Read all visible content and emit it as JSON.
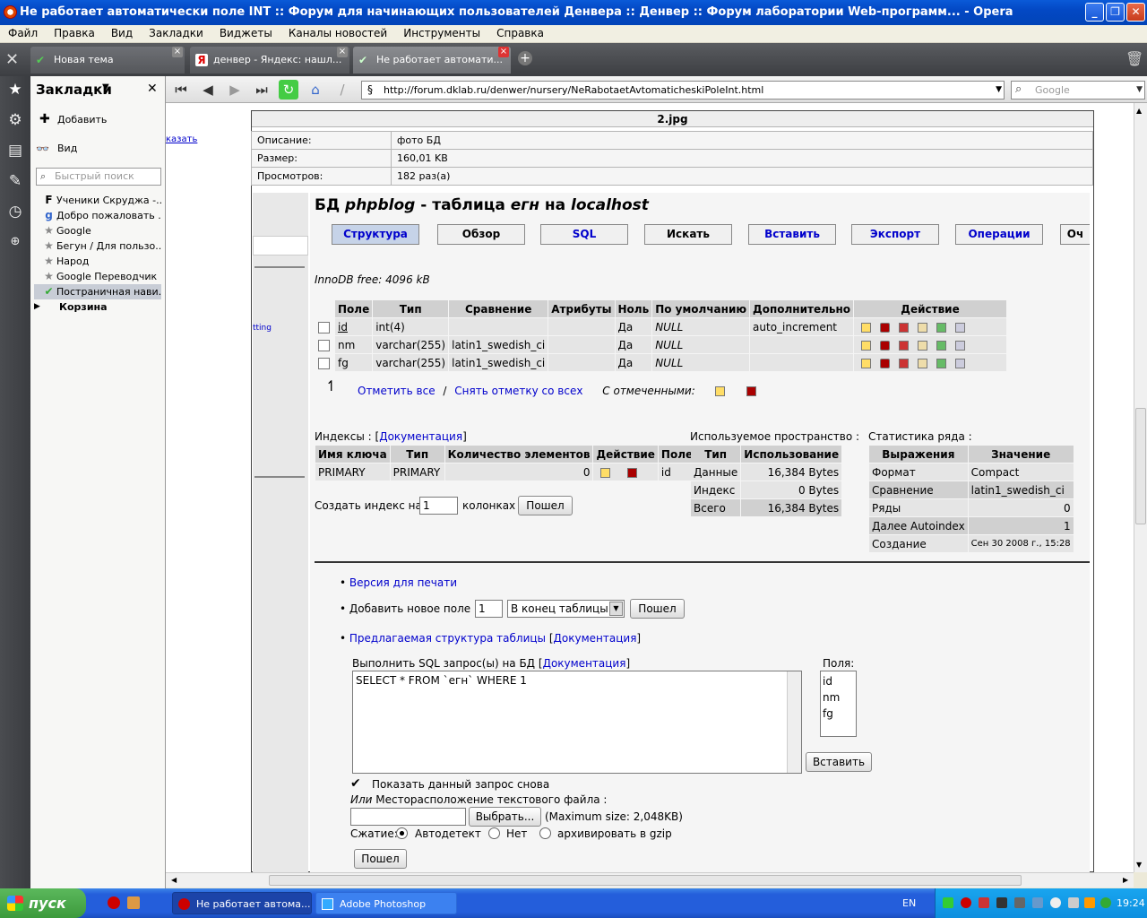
{
  "window": {
    "title": "Не работает автоматически поле INT :: Форум для начинающих пользователей Денвера :: Денвер :: Форум лаборатории Web-программ... - Opera"
  },
  "menu": [
    "Файл",
    "Правка",
    "Вид",
    "Закладки",
    "Виджеты",
    "Каналы новостей",
    "Инструменты",
    "Справка"
  ],
  "tabs": [
    {
      "label": "Новая тема"
    },
    {
      "label": "денвер - Яндекс: нашл..."
    },
    {
      "label": "Не работает автомати..."
    }
  ],
  "panel": {
    "title": "Закладки",
    "add": "Добавить",
    "view": "Вид",
    "search_placeholder": "Быстрый поиск",
    "items": [
      {
        "label": "Ученики Скруджа -..."
      },
      {
        "label": "Добро пожаловать ..."
      },
      {
        "label": "Google"
      },
      {
        "label": "Бегун / Для пользо..."
      },
      {
        "label": "Народ"
      },
      {
        "label": "Google Переводчик"
      },
      {
        "label": "Постраничная нави..."
      },
      {
        "label": "Корзина"
      }
    ]
  },
  "toolbar": {
    "address": "http://forum.dklab.ru/denwer/nursery/NeRabotaetAvtomaticheskiPoleInt.html",
    "search_placeholder": "Google"
  },
  "page": {
    "left_link": "казать",
    "left_link2": "tting",
    "image_title": "2.jpg",
    "info": [
      {
        "k": "Описание:",
        "v": "фото БД"
      },
      {
        "k": "Размер:",
        "v": "160,01 KB"
      },
      {
        "k": "Просмотров:",
        "v": "182 раз(а)"
      }
    ]
  },
  "pma": {
    "heading_pre": "БД ",
    "heading_db": "phpblog",
    "heading_mid": " - таблица ",
    "heading_table": "егн",
    "heading_on": " на ",
    "heading_host": "localhost",
    "tabs": [
      "Структура",
      "Обзор",
      "SQL",
      "Искать",
      "Вставить",
      "Экспорт",
      "Операции",
      "Оч"
    ],
    "innodb": "InnoDB free: 4096 kB",
    "cols": [
      "Поле",
      "Тип",
      "Сравнение",
      "Атрибуты",
      "Ноль",
      "По умолчанию",
      "Дополнительно",
      "Действие"
    ],
    "rows": [
      {
        "field": "id",
        "type": "int(4)",
        "collation": "",
        "attr": "",
        "null": "Да",
        "default": "NULL",
        "extra": "auto_increment"
      },
      {
        "field": "nm",
        "type": "varchar(255)",
        "collation": "latin1_swedish_ci",
        "attr": "",
        "null": "Да",
        "default": "NULL",
        "extra": ""
      },
      {
        "field": "fg",
        "type": "varchar(255)",
        "collation": "latin1_swedish_ci",
        "attr": "",
        "null": "Да",
        "default": "NULL",
        "extra": ""
      }
    ],
    "check_all": "Отметить все",
    "slash": "/",
    "uncheck_all": "Снять отметку со всех",
    "with_selected": "С отмеченными:",
    "indexes_label": "Индексы : [",
    "docs": "Документация",
    "close_br": "]",
    "idx_cols": [
      "Имя ключа",
      "Тип",
      "Количество элементов",
      "Действие",
      "Поле"
    ],
    "idx_row": {
      "name": "PRIMARY",
      "type": "PRIMARY",
      "count": "0",
      "field": "id"
    },
    "create_index": "Создать индекс на",
    "create_index_value": "1",
    "columns_word": "колонках",
    "go": "Пошел",
    "space_title": "Используемое пространство :",
    "space_cols": [
      "Тип",
      "Использование"
    ],
    "space_rows": [
      {
        "t": "Данные",
        "v": "16,384",
        "u": "Bytes"
      },
      {
        "t": "Индекс",
        "v": "0",
        "u": "Bytes"
      },
      {
        "t": "Всего",
        "v": "16,384",
        "u": "Bytes"
      }
    ],
    "stats_title": "Статистика ряда :",
    "stats_cols": [
      "Выражения",
      "Значение"
    ],
    "stats_rows": [
      {
        "k": "Формат",
        "v": "Compact"
      },
      {
        "k": "Сравнение",
        "v": "latin1_swedish_ci"
      },
      {
        "k": "Ряды",
        "v": "0"
      },
      {
        "k": "Далее Autoindex",
        "v": "1"
      },
      {
        "k": "Создание",
        "v": "Сен 30 2008 г., 15:28"
      }
    ],
    "print_version": "Версия для печати",
    "add_field": "Добавить новое поле :",
    "add_field_value": "1",
    "add_position": "В конец таблицы",
    "proposed": "Предлагаемая структура таблицы",
    "run_sql_pre": "Выполнить SQL запрос(ы) на БД [",
    "sql_text": "SELECT * FROM `егн` WHERE 1",
    "fields_label": "Поля:",
    "fields": [
      "id",
      "nm",
      "fg"
    ],
    "insert": "Вставить",
    "show_again": "Показать данный запрос снова",
    "or_word": "Или",
    "file_location": " Месторасположение текстового файла :",
    "browse": "Выбрать...",
    "max_size": "(Maximum size: 2,048KB)",
    "compression": "Сжатие:",
    "comp_options": [
      "Автодетект",
      "Нет",
      "архивировать в gzip"
    ]
  },
  "taskbar": {
    "start": "пуск",
    "tasks": [
      {
        "label": "Не работает автома..."
      },
      {
        "label": "Adobe Photoshop"
      }
    ],
    "lang": "EN",
    "clock": "19:24"
  },
  "colors": {
    "link": "#0000cc",
    "titlebar": "#0348c4",
    "tab_active": "#c6d3e8"
  }
}
